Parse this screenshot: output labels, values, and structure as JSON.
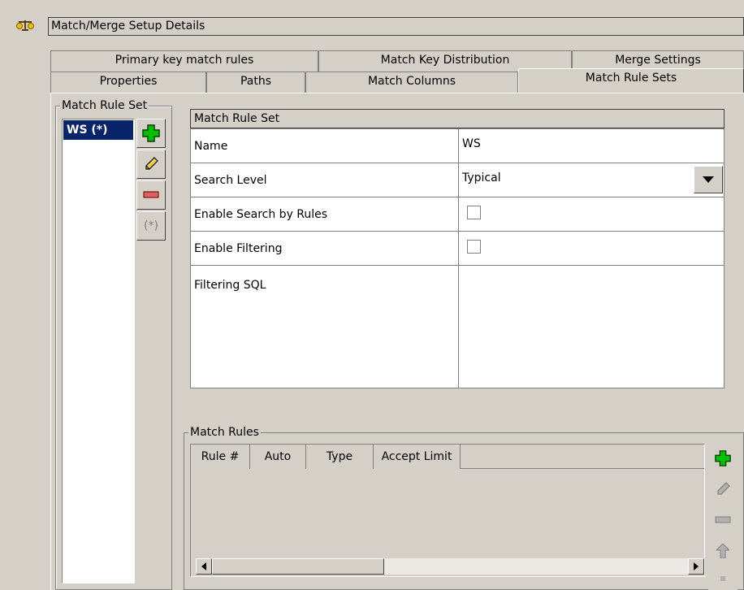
{
  "title": {
    "icon": "balance-scale-icon",
    "text": "Match/Merge Setup Details"
  },
  "tabs_row_back": [
    {
      "label": "Primary key match rules"
    },
    {
      "label": "Match Key Distribution"
    },
    {
      "label": "Merge Settings"
    }
  ],
  "tabs_row_front": [
    {
      "label": "Properties"
    },
    {
      "label": "Paths"
    },
    {
      "label": "Match Columns"
    },
    {
      "label": "Match Rule Sets",
      "selected": true
    }
  ],
  "rule_set_panel": {
    "legend": "Match Rule Set",
    "items": [
      {
        "label": "WS (*)",
        "selected": true
      }
    ],
    "buttons": [
      {
        "icon": "add-icon"
      },
      {
        "icon": "edit-pencil-icon"
      },
      {
        "icon": "remove-icon"
      },
      {
        "icon": "set-default-icon",
        "label": "(*)"
      }
    ]
  },
  "properties": {
    "header": "Match Rule Set",
    "rows": [
      {
        "label": "Name",
        "value": "WS"
      },
      {
        "label": "Search Level",
        "value": "Typical"
      },
      {
        "label": "Enable Search by Rules",
        "checked": false
      },
      {
        "label": "Enable Filtering",
        "checked": false
      },
      {
        "label": "Filtering SQL",
        "value": ""
      }
    ]
  },
  "match_rules": {
    "legend": "Match Rules",
    "columns": [
      "Rule #",
      "Auto",
      "Type",
      "Accept Limit"
    ],
    "rows": [],
    "buttons": [
      {
        "icon": "add-icon"
      },
      {
        "icon": "edit-pencil-icon"
      },
      {
        "icon": "remove-icon"
      },
      {
        "icon": "move-up-icon"
      },
      {
        "icon": "move-down-icon"
      }
    ]
  },
  "colors": {
    "background": "#d4d0c8",
    "selection": "#0a246a",
    "add_green": "#00c000",
    "remove_red": "#e06060"
  }
}
